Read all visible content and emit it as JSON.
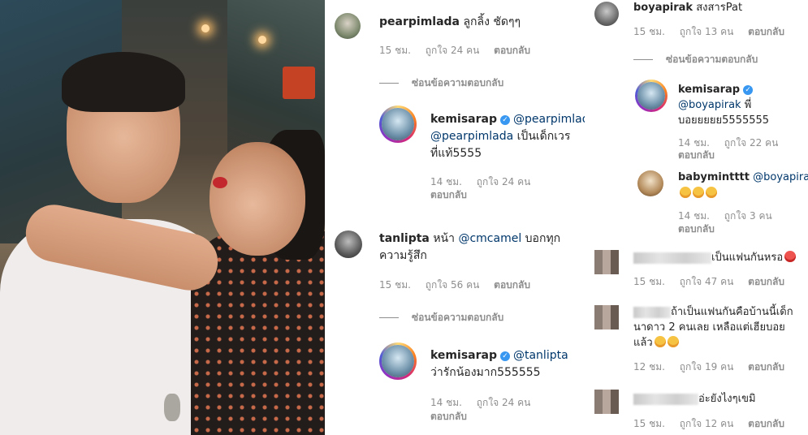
{
  "col1": {
    "c1": {
      "user": "pearpimlada",
      "text": "ลูกลิ้ง ชัดๆๆ",
      "time": "15 ชม.",
      "likes": "ถูกใจ 24 คน",
      "reply": "ตอบกลับ"
    },
    "hide1": "ซ่อนข้อความตอบกลับ",
    "r1": {
      "user": "kemisarap",
      "mention": "@pearpimlada",
      "text1": "เป็นเด็กเวร",
      "text2": "ที่แท้5555",
      "time": "14 ชม.",
      "likes": "ถูกใจ 24 คน",
      "reply": "ตอบกลับ"
    },
    "c2": {
      "user": "tanlipta",
      "text_pre": "หน้า",
      "mention": "@cmcamel",
      "text_post": "บอกทุก",
      "text2": "ความรู้สึก",
      "time": "15 ชม.",
      "likes": "ถูกใจ 56 คน",
      "reply": "ตอบกลับ"
    },
    "hide2": "ซ่อนข้อความตอบกลับ",
    "r2": {
      "user": "kemisarap",
      "mention": "@tanlipta",
      "text2": "ว่ารักน้องมาก555555",
      "time": "14 ชม.",
      "likes": "ถูกใจ 24 คน",
      "reply": "ตอบกลับ"
    }
  },
  "col2": {
    "c1": {
      "user": "boyapirak",
      "text": "สงสารPat",
      "time": "15 ชม.",
      "likes": "ถูกใจ 13 คน",
      "reply": "ตอบกลับ"
    },
    "hide1": "ซ่อนข้อความตอบกลับ",
    "r1": {
      "user": "kemisarap",
      "mention": "@boyapirak",
      "text1": "พี่",
      "text2": "บอยยยยย5555555",
      "time": "14 ชม.",
      "likes": "ถูกใจ 22 คน",
      "reply": "ตอบกลับ"
    },
    "r2": {
      "user": "babymintttt",
      "mention": "@boyapirak",
      "time": "14 ชม.",
      "likes": "ถูกใจ 3 คน",
      "reply": "ตอบกลับ"
    },
    "c2": {
      "text": "เป็นแฟนกันหรอ",
      "time": "15 ชม.",
      "likes": "ถูกใจ 47 คน",
      "reply": "ตอบกลับ"
    },
    "c3": {
      "text1": "ถ้าเป็นแฟนกันคือบ้านนี้เด็ก",
      "text2": "นาดาว 2 คนเลย เหลือแต่เฮียบอย",
      "text3": "แล้ว",
      "time": "12 ชม.",
      "likes": "ถูกใจ 19 คน",
      "reply": "ตอบกลับ"
    },
    "c4": {
      "text": "อ่ะยังไงๆเขมิ",
      "time": "15 ชม.",
      "likes": "ถูกใจ 12 คน",
      "reply": "ตอบกลับ"
    }
  }
}
